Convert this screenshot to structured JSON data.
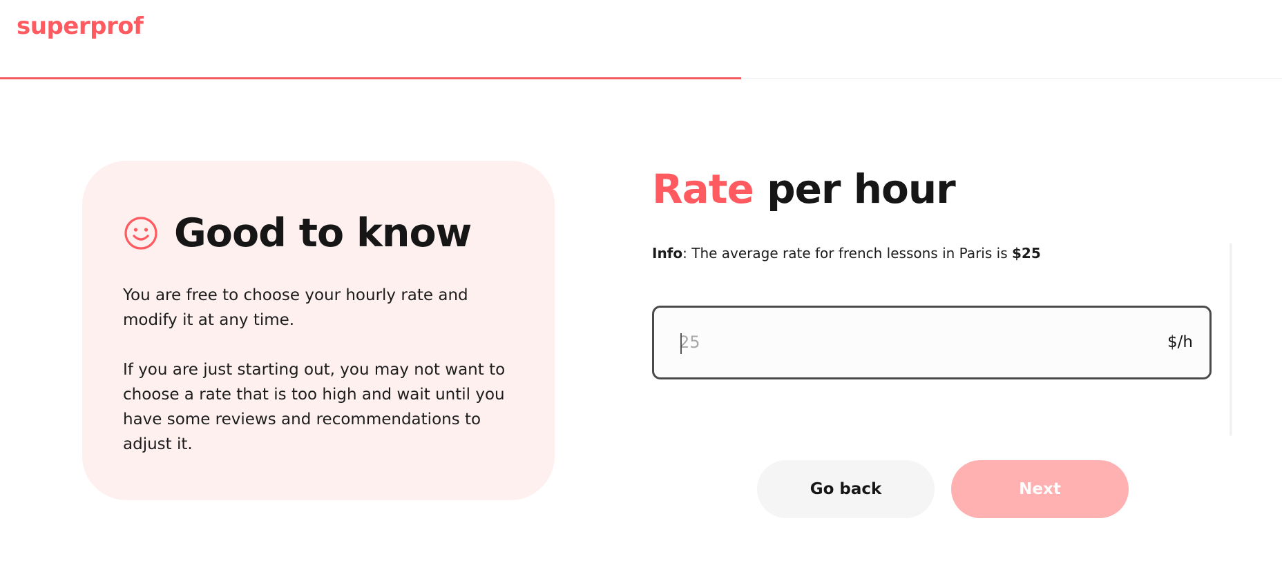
{
  "header": {
    "logo": "superprof",
    "progress": 0.578
  },
  "colors": {
    "brand": "#ff5a5f",
    "card_bg": "#fff0f0",
    "next_disabled": "#ffb0b1"
  },
  "card": {
    "icon": "smile-icon",
    "title": "Good to know",
    "paragraph1": "You are free to choose your hourly rate and modify it at any time.",
    "paragraph2": "If you are just starting out, you may not want to choose a rate that is too high and wait until you have some reviews and recommendations to adjust it."
  },
  "main": {
    "title_accent": "Rate",
    "title_rest": " per hour",
    "info_label": "Info",
    "info_text": ": The average rate for french lessons in Paris is ",
    "info_value": "$25",
    "rate_input": {
      "value": "",
      "placeholder": "25",
      "unit": "$/h"
    }
  },
  "actions": {
    "back_label": "Go back",
    "next_label": "Next"
  }
}
